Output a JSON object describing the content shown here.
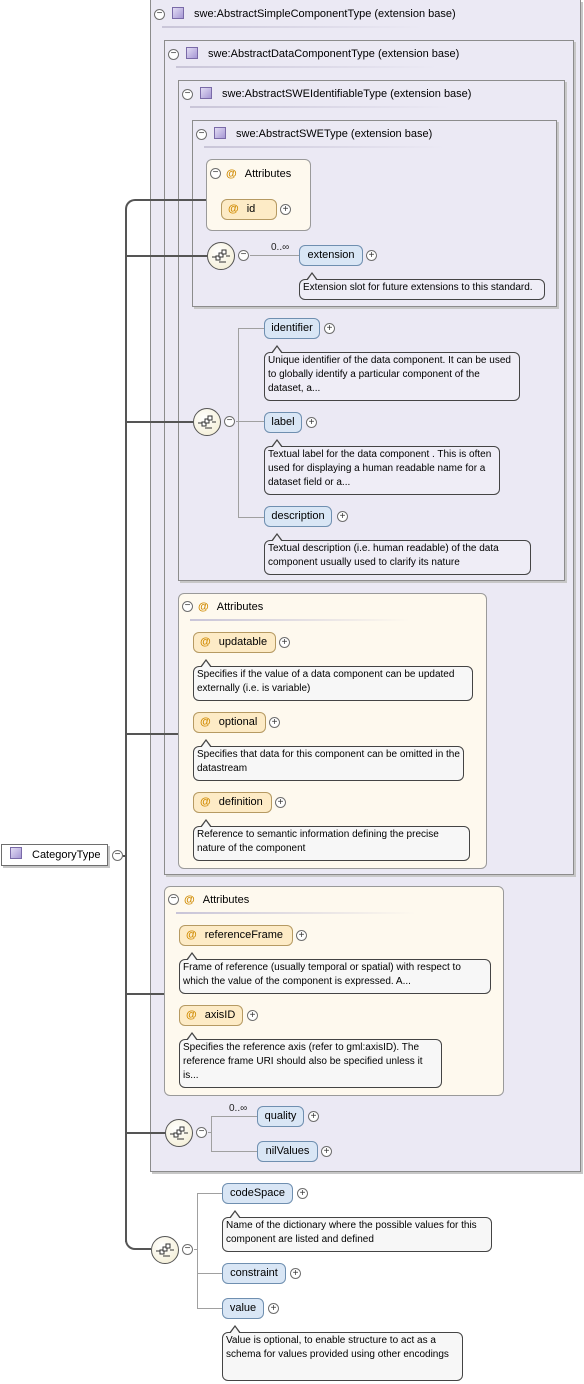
{
  "root": {
    "label": "CategoryType"
  },
  "types": {
    "simple": "swe:AbstractSimpleComponentType (extension base)",
    "data": "swe:AbstractDataComponentType (extension base)",
    "identifiable": "swe:AbstractSWEIdentifiableType (extension base)",
    "swe": "swe:AbstractSWEType (extension base)"
  },
  "attributes_label": "Attributes",
  "at_symbol": "@",
  "swe_type": {
    "attr_id": "id",
    "cardinality": "0..∞",
    "extension": "extension",
    "extension_doc": "Extension slot for future extensions to this standard."
  },
  "identifiable": {
    "identifier": "identifier",
    "identifier_doc": "Unique identifier of the data component. It can be used to globally identify a particular component of the dataset, a...",
    "label": "label",
    "label_doc": "Textual label for the data component . This is often used for displaying a human readable name for a dataset field or a...",
    "description": "description",
    "description_doc": "Textual description (i.e. human readable) of the data component usually used to clarify its nature"
  },
  "data_attrs": [
    {
      "name": "updatable",
      "doc": "Specifies if the value of a data component can be updated externally (i.e. is variable)"
    },
    {
      "name": "optional",
      "doc": "Specifies that data for this component can be omitted in the datastream"
    },
    {
      "name": "definition",
      "doc": "Reference to semantic information defining the precise nature of the component"
    }
  ],
  "simple_attrs": [
    {
      "name": "referenceFrame",
      "doc": "Frame of reference (usually temporal or spatial) with respect to which the value of the component is expressed. A..."
    },
    {
      "name": "axisID",
      "doc": "Specifies the reference axis (refer to gml:axisID). The reference frame URI should also be specified unless it is..."
    }
  ],
  "simple_seq": {
    "cardinality": "0..∞",
    "quality": "quality",
    "nilValues": "nilValues"
  },
  "category_seq": {
    "codeSpace": "codeSpace",
    "codeSpace_doc": "Name of the dictionary where the possible values for this component are listed and defined",
    "constraint": "constraint",
    "value": "value",
    "value_doc": "Value is optional, to enable structure to act as a schema for values provided using other encodings"
  },
  "colors": {
    "type_bg": "#ebe9f4",
    "attr_bg": "#fef9ee",
    "element_bg": "#d9e6f5",
    "attribute_bg": "#fdebc6",
    "attr_at": "#d08a00"
  },
  "icons": [
    "minus-icon",
    "plus-icon",
    "type-icon",
    "attribute-icon",
    "sequence-icon"
  ]
}
